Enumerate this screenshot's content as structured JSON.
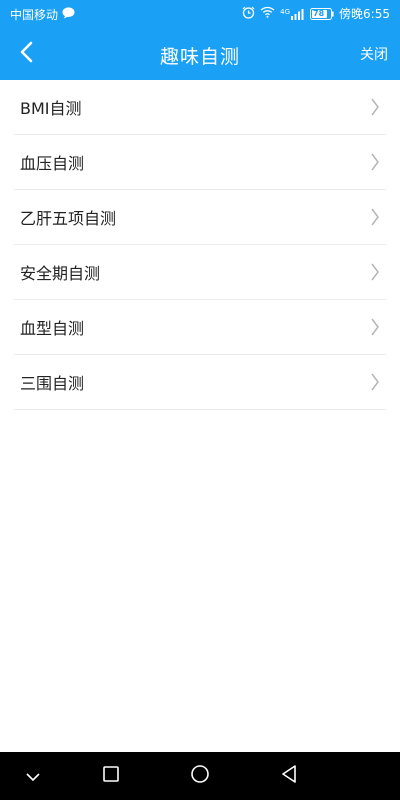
{
  "status_bar": {
    "carrier": "中国移动",
    "time": "傍晚6:55",
    "signal": "4G",
    "battery": "78",
    "icons": [
      "chat-bubble-icon",
      "alarm-icon",
      "wifi-icon",
      "signal-icon",
      "battery-icon"
    ]
  },
  "header": {
    "title": "趣味自测",
    "close_label": "关闭",
    "back_icon": "chevron-left-icon"
  },
  "list": {
    "items": [
      {
        "label": "BMI自测"
      },
      {
        "label": "血压自测"
      },
      {
        "label": "乙肝五项自测"
      },
      {
        "label": "安全期自测"
      },
      {
        "label": "血型自测"
      },
      {
        "label": "三围自测"
      }
    ]
  },
  "nav_bar": {
    "icons": [
      "chevron-down-icon",
      "square-icon",
      "circle-icon",
      "triangle-back-icon"
    ]
  },
  "colors": {
    "accent": "#1aa0f5",
    "nav_background": "#000000",
    "divider": "#ececec",
    "chevron": "#b5b5b5"
  }
}
